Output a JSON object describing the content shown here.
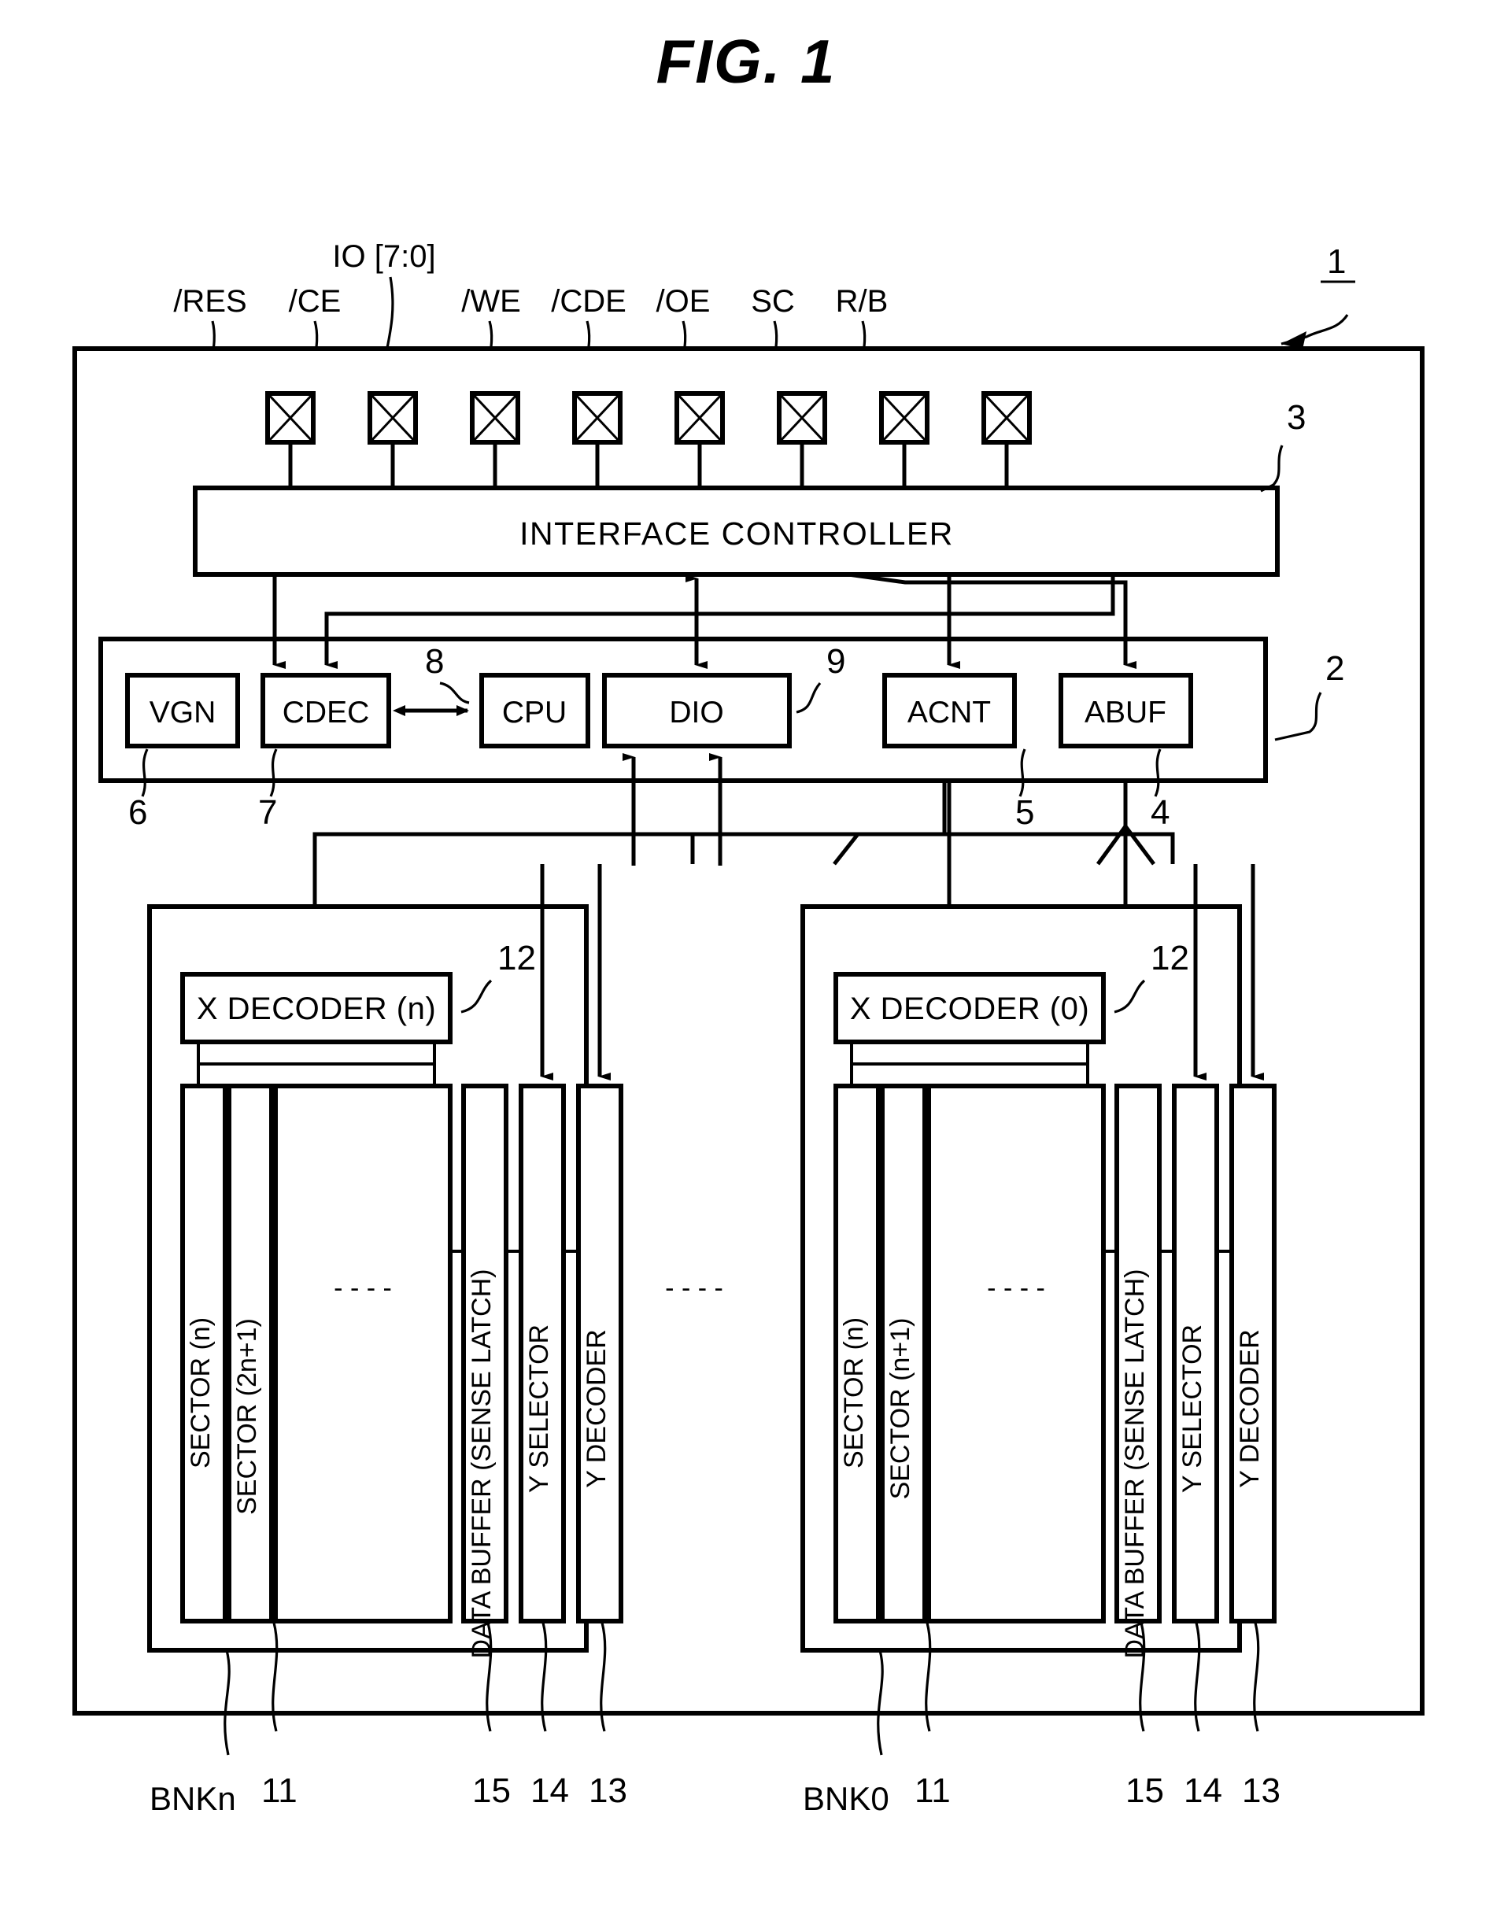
{
  "figure": {
    "title": "FIG.  1",
    "device_ref": "1"
  },
  "pins": [
    {
      "label": "/RES",
      "name": "pin-res"
    },
    {
      "label": "/CE",
      "name": "pin-ce"
    },
    {
      "label": "IO [7:0]",
      "name": "pin-io"
    },
    {
      "label": "/WE",
      "name": "pin-we"
    },
    {
      "label": "/CDE",
      "name": "pin-cde"
    },
    {
      "label": "/OE",
      "name": "pin-oe"
    },
    {
      "label": "SC",
      "name": "pin-sc"
    },
    {
      "label": "R/B",
      "name": "pin-rb"
    }
  ],
  "interface": {
    "label": "INTERFACE CONTROLLER",
    "ref": "3"
  },
  "control_block": {
    "ref": "2",
    "blocks": [
      {
        "label": "VGN",
        "ref": "6"
      },
      {
        "label": "CDEC",
        "ref": "7"
      },
      {
        "label": "CPU",
        "ref": "8"
      },
      {
        "label": "DIO",
        "ref": "9"
      },
      {
        "label": "ACNT",
        "ref": "5"
      },
      {
        "label": "ABUF",
        "ref": "4"
      }
    ]
  },
  "banks": [
    {
      "name": "BNKn",
      "x_decoder": {
        "label": "X DECODER (n)",
        "ref": "12"
      },
      "columns": [
        {
          "label": "SECTOR (n)",
          "ref": "11"
        },
        {
          "label": "SECTOR (2n+1)",
          "ref": "11"
        },
        {
          "label": "DATA BUFFER (SENSE LATCH)",
          "ref": "15"
        },
        {
          "label": "Y SELECTOR",
          "ref": "14"
        },
        {
          "label": "Y DECODER",
          "ref": "13"
        }
      ],
      "bottom_refs": [
        "11",
        "15",
        "14",
        "13"
      ],
      "ellipsis": "- - - -"
    },
    {
      "name": "BNK0",
      "x_decoder": {
        "label": "X DECODER (0)",
        "ref": "12"
      },
      "columns": [
        {
          "label": "SECTOR (n)",
          "ref": "11"
        },
        {
          "label": "SECTOR (n+1)",
          "ref": "11"
        },
        {
          "label": "DATA BUFFER (SENSE LATCH)",
          "ref": "15"
        },
        {
          "label": "Y SELECTOR",
          "ref": "14"
        },
        {
          "label": "Y DECODER",
          "ref": "13"
        }
      ],
      "bottom_refs": [
        "11",
        "15",
        "14",
        "13"
      ],
      "ellipsis": "- - - -"
    }
  ],
  "between_banks_ellipsis": "- - - -",
  "colors": {
    "ink": "#000000",
    "paper": "#ffffff"
  }
}
